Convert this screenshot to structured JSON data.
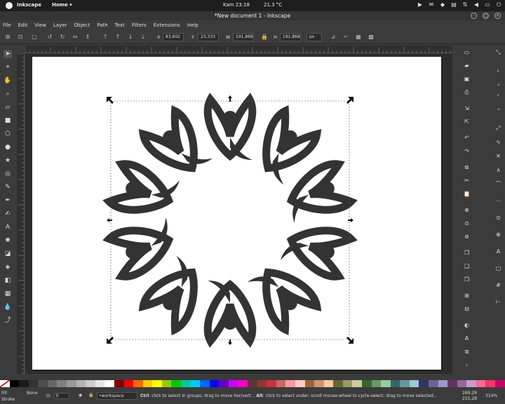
{
  "system_bar": {
    "app_name": "Inkscape",
    "home_menu": "Home ▾",
    "clock": "Kam 23:18",
    "weather": "21.3 °C"
  },
  "window": {
    "title": "*New document 1 - Inkscape"
  },
  "menu": [
    "File",
    "Edit",
    "View",
    "Layer",
    "Object",
    "Path",
    "Text",
    "Filters",
    "Extensions",
    "Help"
  ],
  "toolbar": {
    "x_label": "X",
    "x_value": "83,602",
    "y_label": "Y",
    "y_value": "23,333",
    "w_label": "W",
    "w_value": "191,868",
    "h_label": "H",
    "h_value": "191,868",
    "unit": "px"
  },
  "status": {
    "fill_label": "Fill",
    "stroke_label": "Stroke",
    "fill_value": "",
    "stroke_value": "None",
    "opacity_label": "O:",
    "opacity_value": "0",
    "layer": "•workspace",
    "message_ctrl": "Ctrl",
    "message_1": ": click to select in groups; drag to move hor/vert; ; ",
    "message_alt": "Alt",
    "message_2": ": click to select under; scroll mouse-wheel to cycle-select; drag to move selected...",
    "coord_x": "269,29",
    "coord_y": "215,28",
    "zoom": "314%"
  },
  "colors": {
    "shape_fill": "#333333",
    "page": "#ffffff",
    "canvas": "#2d2d2d"
  },
  "palette": [
    "#000000",
    "#1a1a1a",
    "#333333",
    "#4d4d4d",
    "#666666",
    "#808080",
    "#999999",
    "#b3b3b3",
    "#cccccc",
    "#e6e6e6",
    "#ffffff",
    "#800000",
    "#ff0000",
    "#ff6600",
    "#ffcc00",
    "#ffff00",
    "#99cc00",
    "#00cc00",
    "#00cc99",
    "#00ccff",
    "#0066ff",
    "#0000ff",
    "#6600cc",
    "#cc00ff",
    "#ff00cc",
    "#663333",
    "#993333",
    "#cc3333",
    "#cc6666",
    "#ff9999",
    "#ffcccc",
    "#996633",
    "#cc9966",
    "#ffcc99",
    "#666633",
    "#999966",
    "#cccc99",
    "#336633",
    "#669966",
    "#99cc99",
    "#336666",
    "#669999",
    "#99cccc",
    "#333366",
    "#666699",
    "#9999cc",
    "#663366",
    "#996699",
    "#cc99cc",
    "#ff6699",
    "#ff3366",
    "#cc0066"
  ]
}
